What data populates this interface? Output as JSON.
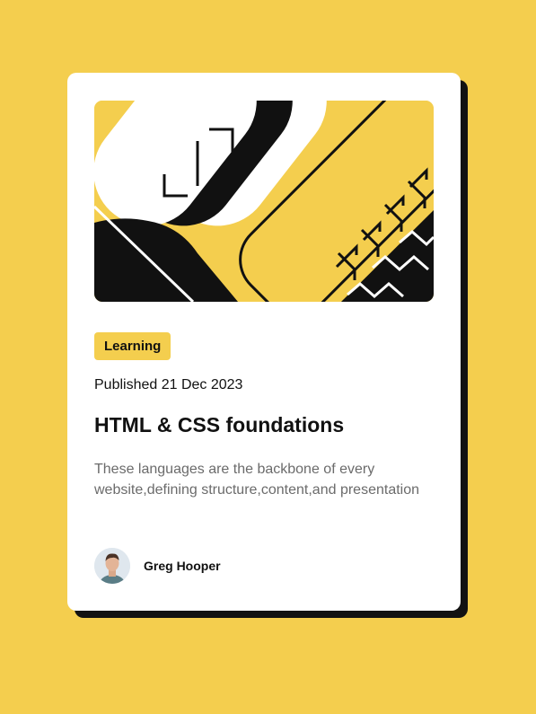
{
  "colors": {
    "background": "#F4CE4E",
    "card": "#FFFFFF",
    "shadow": "#121212",
    "text": "#111111",
    "muted_text": "#6B6B6B"
  },
  "card": {
    "hero_image": "blog-illustration",
    "tag": "Learning",
    "published": "Published 21 Dec 2023",
    "title": "HTML & CSS foundations",
    "description": "These languages are the backbone of every website,defining structure,content,and presentation",
    "author": {
      "name": "Greg Hooper",
      "avatar": "author-avatar"
    }
  }
}
